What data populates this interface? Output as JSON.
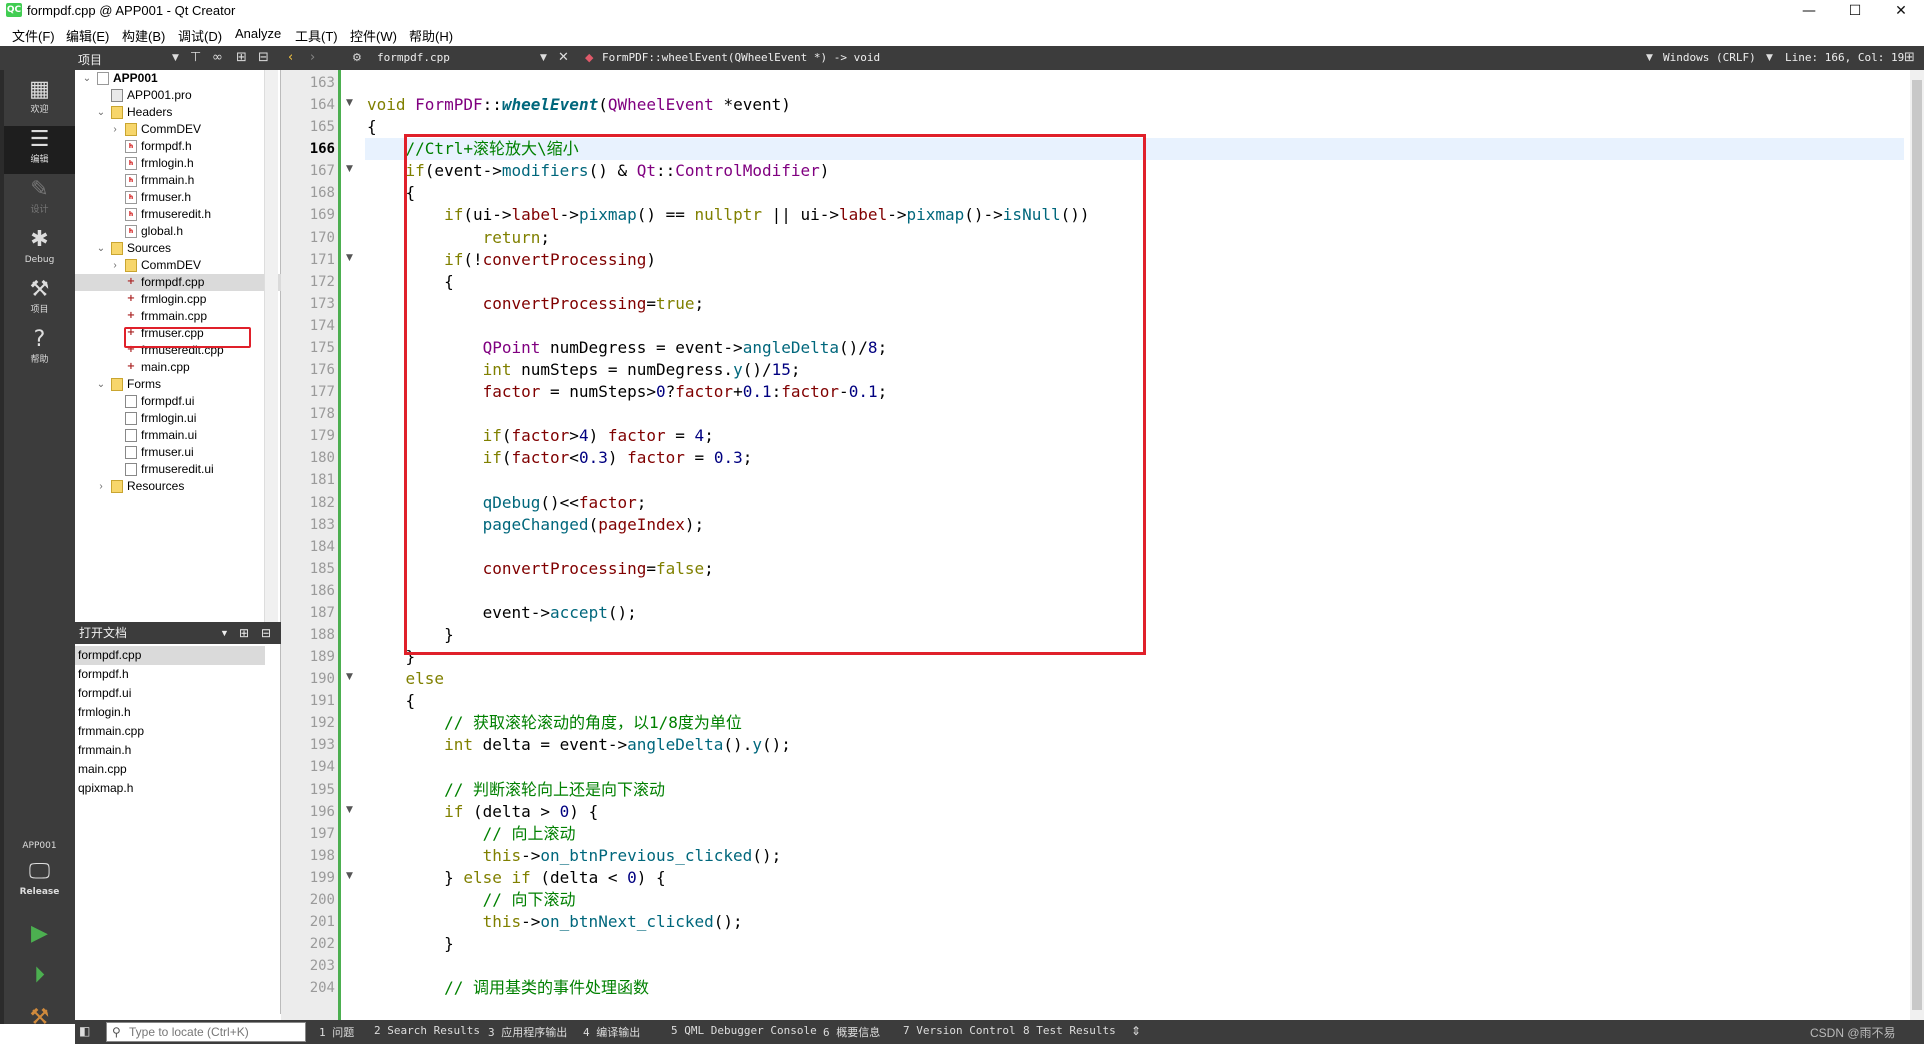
{
  "window": {
    "title": "formpdf.cpp @ APP001 - Qt Creator",
    "logo_text": "QC",
    "controls": [
      "—",
      "☐",
      "✕"
    ]
  },
  "menu": [
    "文件(F)",
    "编辑(E)",
    "构建(B)",
    "调试(D)",
    "Analyze",
    "工具(T)",
    "控件(W)",
    "帮助(H)"
  ],
  "toolbar": {
    "panel_title": "项目",
    "file_tab": "formpdf.cpp",
    "symbol": "FormPDF::wheelEvent(QWheelEvent *) -> void",
    "line_ending": "Windows (CRLF)",
    "position": "Line: 166, Col: 19"
  },
  "modes": [
    {
      "icon": "welcome-icon",
      "label": "欢迎"
    },
    {
      "icon": "edit-icon",
      "label": "编辑"
    },
    {
      "icon": "design-icon",
      "label": "设计"
    },
    {
      "icon": "debug-icon",
      "label": "Debug"
    },
    {
      "icon": "project-icon",
      "label": "项目"
    },
    {
      "icon": "help-icon",
      "label": "帮助"
    }
  ],
  "kit": {
    "project": "APP001",
    "build": "Release"
  },
  "tree": [
    {
      "label": "APP001",
      "level": 0,
      "kind": "project",
      "expanded": true
    },
    {
      "label": "APP001.pro",
      "level": 1,
      "kind": "pro"
    },
    {
      "label": "Headers",
      "level": 1,
      "kind": "folderopen",
      "expanded": true
    },
    {
      "label": "CommDEV",
      "level": 2,
      "kind": "folder",
      "expanded": false
    },
    {
      "label": "formpdf.h",
      "level": 2,
      "kind": "h"
    },
    {
      "label": "frmlogin.h",
      "level": 2,
      "kind": "h"
    },
    {
      "label": "frmmain.h",
      "level": 2,
      "kind": "h"
    },
    {
      "label": "frmuser.h",
      "level": 2,
      "kind": "h"
    },
    {
      "label": "frmuseredit.h",
      "level": 2,
      "kind": "h"
    },
    {
      "label": "global.h",
      "level": 2,
      "kind": "h"
    },
    {
      "label": "Sources",
      "level": 1,
      "kind": "folderopen",
      "expanded": true
    },
    {
      "label": "CommDEV",
      "level": 2,
      "kind": "folder",
      "expanded": false
    },
    {
      "label": "formpdf.cpp",
      "level": 2,
      "kind": "cpp",
      "selected": true
    },
    {
      "label": "frmlogin.cpp",
      "level": 2,
      "kind": "cpp"
    },
    {
      "label": "frmmain.cpp",
      "level": 2,
      "kind": "cpp"
    },
    {
      "label": "frmuser.cpp",
      "level": 2,
      "kind": "cpp"
    },
    {
      "label": "frmuseredit.cpp",
      "level": 2,
      "kind": "cpp"
    },
    {
      "label": "main.cpp",
      "level": 2,
      "kind": "cpp"
    },
    {
      "label": "Forms",
      "level": 1,
      "kind": "folderopen",
      "expanded": true
    },
    {
      "label": "formpdf.ui",
      "level": 2,
      "kind": "ui"
    },
    {
      "label": "frmlogin.ui",
      "level": 2,
      "kind": "ui"
    },
    {
      "label": "frmmain.ui",
      "level": 2,
      "kind": "ui"
    },
    {
      "label": "frmuser.ui",
      "level": 2,
      "kind": "ui"
    },
    {
      "label": "frmuseredit.ui",
      "level": 2,
      "kind": "ui"
    },
    {
      "label": "Resources",
      "level": 1,
      "kind": "folder",
      "expanded": false
    }
  ],
  "open_docs": {
    "title": "打开文档",
    "items": [
      "formpdf.cpp",
      "formpdf.h",
      "formpdf.ui",
      "frmlogin.h",
      "frmmain.cpp",
      "frmmain.h",
      "main.cpp",
      "qpixmap.h"
    ]
  },
  "editor": {
    "current_line": 166,
    "lines": [
      {
        "n": 163,
        "t": ""
      },
      {
        "n": 164,
        "fold": true,
        "t": "[[kw:void]] [[ty:FormPDF]]::[[fni:wheelEvent]]([[ty:QWheelEvent]] *event)"
      },
      {
        "n": 165,
        "t": "{"
      },
      {
        "n": 166,
        "t": "    [[cm://Ctrl+滚轮放大\\缩小]]"
      },
      {
        "n": 167,
        "fold": true,
        "t": "    [[kw:if]](event->[[fn:modifiers]]() & [[ty:Qt]]::[[ty:ControlModifier]])"
      },
      {
        "n": 168,
        "t": "    {"
      },
      {
        "n": 169,
        "t": "        [[kw:if]](ui->[[mem:label]]->[[fn:pixmap]]() == [[kw:nullptr]] || ui->[[mem:label]]->[[fn:pixmap]]()->[[fn:isNull]]())"
      },
      {
        "n": 170,
        "t": "            [[kw:return]];"
      },
      {
        "n": 171,
        "fold": true,
        "t": "        [[kw:if]](![[mem:convertProcessing]])"
      },
      {
        "n": 172,
        "t": "        {"
      },
      {
        "n": 173,
        "t": "            [[mem:convertProcessing]]=[[kw:true]];"
      },
      {
        "n": 174,
        "t": ""
      },
      {
        "n": 175,
        "t": "            [[ty:QPoint]] numDegress = event->[[fn:angleDelta]]()/[[num:8]];"
      },
      {
        "n": 176,
        "t": "            [[kw:int]] numSteps = numDegress.[[fn:y]]()/[[num:15]];"
      },
      {
        "n": 177,
        "t": "            [[mem:factor]] = numSteps>[[num:0]]?[[mem:factor]]+[[num:0.1]]:[[mem:factor]]-[[num:0.1]];"
      },
      {
        "n": 178,
        "t": ""
      },
      {
        "n": 179,
        "t": "            [[kw:if]]([[mem:factor]]>[[num:4]]) [[mem:factor]] = [[num:4]];"
      },
      {
        "n": 180,
        "t": "            [[kw:if]]([[mem:factor]]<[[num:0.3]]) [[mem:factor]] = [[num:0.3]];"
      },
      {
        "n": 181,
        "t": ""
      },
      {
        "n": 182,
        "t": "            [[fn:qDebug]]()<<[[mem:factor]];"
      },
      {
        "n": 183,
        "t": "            [[fn:pageChanged]]([[mem:pageIndex]]);"
      },
      {
        "n": 184,
        "t": ""
      },
      {
        "n": 185,
        "t": "            [[mem:convertProcessing]]=[[kw:false]];"
      },
      {
        "n": 186,
        "t": ""
      },
      {
        "n": 187,
        "t": "            event->[[fn:accept]]();"
      },
      {
        "n": 188,
        "t": "        }"
      },
      {
        "n": 189,
        "t": "    }"
      },
      {
        "n": 190,
        "fold": true,
        "t": "    [[kw:else]]"
      },
      {
        "n": 191,
        "t": "    {"
      },
      {
        "n": 192,
        "t": "        [[cm:// 获取滚轮滚动的角度，以1/8度为单位]]"
      },
      {
        "n": 193,
        "t": "        [[kw:int]] delta = event->[[fn:angleDelta]]().[[fn:y]]();"
      },
      {
        "n": 194,
        "t": ""
      },
      {
        "n": 195,
        "t": "        [[cm:// 判断滚轮向上还是向下滚动]]"
      },
      {
        "n": 196,
        "fold": true,
        "t": "        [[kw:if]] (delta > [[num:0]]) {"
      },
      {
        "n": 197,
        "t": "            [[cm:// 向上滚动]]"
      },
      {
        "n": 198,
        "t": "            [[kw:this]]->[[fn:on_btnPrevious_clicked]]();"
      },
      {
        "n": 199,
        "fold": true,
        "t": "        } [[kw:else]] [[kw:if]] (delta < [[num:0]]) {"
      },
      {
        "n": 200,
        "t": "            [[cm:// 向下滚动]]"
      },
      {
        "n": 201,
        "t": "            [[kw:this]]->[[fn:on_btnNext_clicked]]();"
      },
      {
        "n": 202,
        "t": "        }"
      },
      {
        "n": 203,
        "t": ""
      },
      {
        "n": 204,
        "t": "        [[cm:// 调用基类的事件处理函数]]"
      }
    ]
  },
  "statusbar": {
    "locate_placeholder": "Type to locate (Ctrl+K)",
    "panes": [
      "1 问题",
      "2 Search Results",
      "3 应用程序输出",
      "4 编译输出",
      "5 QML Debugger Console",
      "6 概要信息",
      "7 Version Control",
      "8 Test Results"
    ],
    "watermark": "CSDN @雨不易"
  }
}
